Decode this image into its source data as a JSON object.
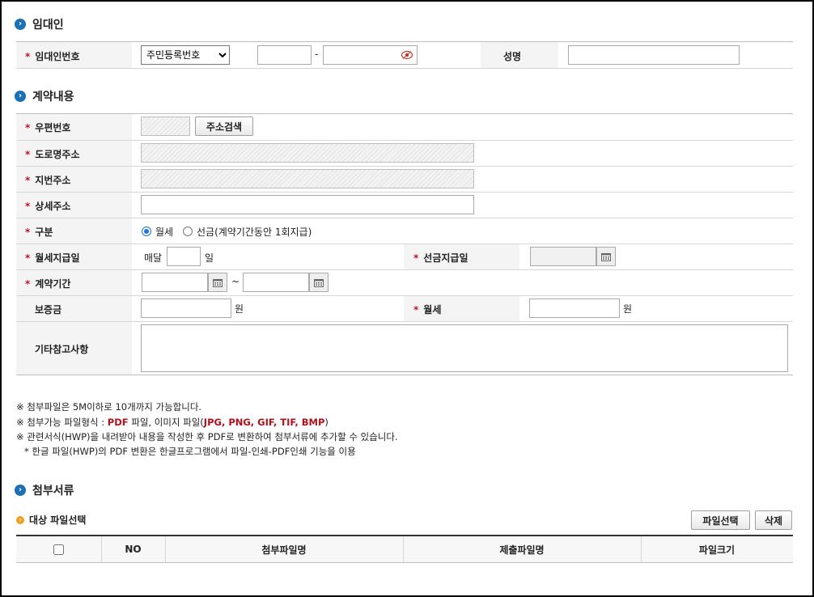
{
  "lessor": {
    "section_title": "임대인",
    "id_label": "임대인번호",
    "id_type_selected": "주민등록번호",
    "id_separator": "-",
    "name_label": "성명"
  },
  "contract": {
    "section_title": "계약내용",
    "postal_label": "우편번호",
    "address_search_button": "주소검색",
    "road_address_label": "도로명주소",
    "lot_address_label": "지번주소",
    "detail_address_label": "상세주소",
    "type_label": "구분",
    "type_options": [
      "월세",
      "선금(계약기간동안 1회지급)"
    ],
    "monthly_pay_day_label": "월세지급일",
    "every_month_text": "매달",
    "day_unit": "일",
    "prepay_date_label": "선금지급일",
    "period_label": "계약기간",
    "period_separator": "~",
    "deposit_label": "보증금",
    "won_unit": "원",
    "monthly_rent_label": "월세",
    "notes_label": "기타참고사항"
  },
  "notices": {
    "line1": "※ 첨부파일은 5M이하로 10개까지 가능합니다.",
    "line2_prefix": "※ 첨부가능 파일형식 : ",
    "line2_pdf": "PDF",
    "line2_mid": " 파일, 이미지 파일(",
    "line2_img": "JPG, PNG, GIF, TIF, BMP",
    "line2_suffix": ")",
    "line3": "※ 관련서식(HWP)을 내려받아 내용을 작성한 후 PDF로 변환하여 첨부서류에 추가할 수 있습니다.",
    "line4": "* 한글 파일(HWP)의 PDF 변환은 한글프로그램에서 파일-인쇄-PDF인쇄 기능을 이용"
  },
  "attachments": {
    "section_title": "첨부서류",
    "target_label": "대상 파일선택",
    "select_file_button": "파일선택",
    "delete_button": "삭제",
    "columns": [
      "NO",
      "첨부파일명",
      "제출파일명",
      "파일크기"
    ]
  },
  "colors": {
    "accent": "#1e6fb5",
    "required": "#c8102e",
    "highlight": "#b1121c"
  }
}
